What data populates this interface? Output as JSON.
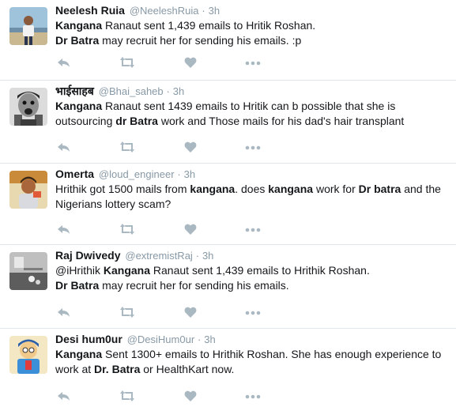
{
  "tweets": [
    {
      "name": "Neelesh Ruia",
      "handle": "@NeeleshRuia",
      "separator": "·",
      "time": "3h",
      "lines": [
        [
          {
            "t": "Kangana",
            "b": true
          },
          {
            "t": " Ranaut sent 1,439 emails to Hritik Roshan."
          }
        ],
        [
          {
            "t": "Dr Batra",
            "b": true
          },
          {
            "t": " may recruit her for sending his emails. :p"
          }
        ]
      ]
    },
    {
      "name": "भाईसाहब",
      "handle": "@Bhai_saheb",
      "separator": "·",
      "time": "3h",
      "lines": [
        [
          {
            "t": "Kangana",
            "b": true
          },
          {
            "t": " Ranaut sent 1439 emails to Hritik can b possible that she is"
          }
        ],
        [
          {
            "t": "outsourcing "
          },
          {
            "t": "dr Batra",
            "b": true
          },
          {
            "t": " work and Those mails for his dad's hair transplant"
          }
        ]
      ]
    },
    {
      "name": "Omerta",
      "handle": "@loud_engineer",
      "separator": "·",
      "time": "3h",
      "lines": [
        [
          {
            "t": "Hrithik got 1500 mails from "
          },
          {
            "t": "kangana",
            "b": true
          },
          {
            "t": ". does "
          },
          {
            "t": "kangana",
            "b": true
          },
          {
            "t": " work for "
          },
          {
            "t": "Dr batra",
            "b": true
          },
          {
            "t": " and the"
          }
        ],
        [
          {
            "t": "Nigerians lottery scam?"
          }
        ]
      ]
    },
    {
      "name": "Raj Dwivedy",
      "handle": "@extremistRaj",
      "separator": "·",
      "time": "3h",
      "lines": [
        [
          {
            "t": "@iHrithik "
          },
          {
            "t": "Kangana",
            "b": true
          },
          {
            "t": " Ranaut sent 1,439 emails to Hrithik Roshan."
          }
        ],
        [
          {
            "t": "Dr Batra",
            "b": true
          },
          {
            "t": " may recruit her for sending his emails."
          }
        ]
      ]
    },
    {
      "name": "Desi hum0ur",
      "handle": "@DesiHum0ur",
      "separator": "·",
      "time": "3h",
      "lines": [
        [
          {
            "t": "Kangana",
            "b": true
          },
          {
            "t": " Sent 1300+ emails to Hrithik Roshan. She has enough experience to"
          }
        ],
        [
          {
            "t": "work at "
          },
          {
            "t": "Dr. Batra",
            "b": true
          },
          {
            "t": " or HealthKart now."
          }
        ]
      ]
    }
  ],
  "icons": {
    "reply": "reply-icon",
    "retweet": "retweet-icon",
    "like": "heart-icon",
    "more": "more-dots-icon"
  },
  "colors": {
    "name": "#14171a",
    "meta": "#8899a6",
    "action_icon": "#aab8c2",
    "divider": "#e1e8ed"
  }
}
